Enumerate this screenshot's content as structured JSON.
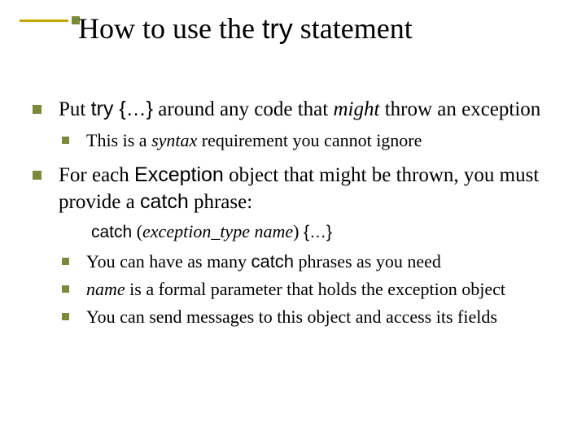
{
  "title": {
    "pre": "How to use the ",
    "code": "try",
    "post": " statement"
  },
  "b1": {
    "pre": "Put ",
    "code": "try {…}",
    "mid": " around any code that ",
    "ital": "might",
    "post": " throw an exception",
    "sub1": {
      "pre": "This is a ",
      "ital": "syntax",
      "post": " requirement you cannot ignore"
    }
  },
  "b2": {
    "pre": "For each ",
    "code1": "Exception",
    "mid": " object that might be thrown, you must provide a ",
    "code2": "catch",
    "post": " phrase:",
    "catchline": {
      "code1": "catch",
      "open": " (",
      "ital": "exception_type  name",
      "close": ") ",
      "code2": "{…}"
    },
    "sub1": {
      "pre": "You can have as many ",
      "code": "catch",
      "post": " phrases as you need"
    },
    "sub2": {
      "ital": "name",
      "post": " is a formal parameter that holds the exception object"
    },
    "sub3": {
      "text": "You can send messages to this object and access its fields"
    }
  }
}
